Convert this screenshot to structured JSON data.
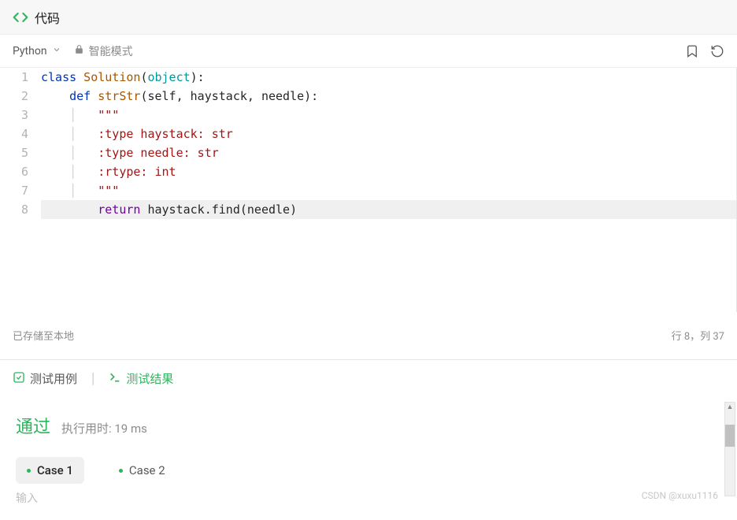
{
  "header": {
    "title": "代码"
  },
  "toolbar": {
    "language": "Python",
    "mode_label": "智能模式"
  },
  "editor": {
    "lines": [
      "1",
      "2",
      "3",
      "4",
      "5",
      "6",
      "7",
      "8"
    ],
    "code": {
      "l1": {
        "kw1": "class",
        "name": " Solution",
        "paren1": "(",
        "obj": "object",
        "paren2": "):"
      },
      "l2": {
        "indent": "    ",
        "kw1": "def",
        "name": " strStr",
        "args": "(self, haystack, needle):"
      },
      "l3": {
        "indent": "        ",
        "doc": "\"\"\""
      },
      "l4": {
        "indent": "        ",
        "doc": ":type haystack: str"
      },
      "l5": {
        "indent": "        ",
        "doc": ":type needle: str"
      },
      "l6": {
        "indent": "        ",
        "doc": ":rtype: int"
      },
      "l7": {
        "indent": "        ",
        "doc": "\"\"\""
      },
      "l8": {
        "indent": "        ",
        "kw1": "return",
        "expr": " haystack.find(needle)"
      }
    }
  },
  "status": {
    "saved": "已存储至本地",
    "cursor": "行 8，列 37"
  },
  "tabs": {
    "testcases": "测试用例",
    "results": "测试结果"
  },
  "result": {
    "pass": "通过",
    "runtime": "执行用时: 19 ms",
    "cases": [
      "Case 1",
      "Case 2"
    ],
    "input_label": "输入"
  },
  "watermark": "CSDN @xuxu1116"
}
